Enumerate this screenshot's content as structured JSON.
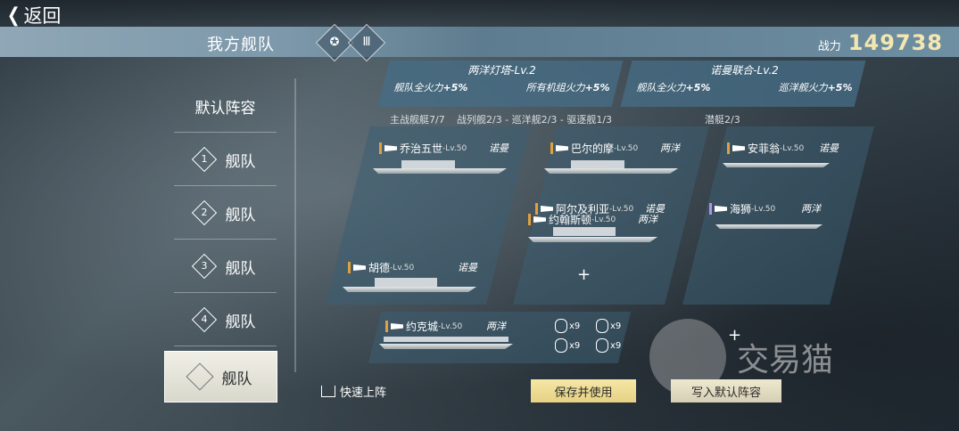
{
  "nav": {
    "back_label": "返回"
  },
  "header": {
    "title": "我方舰队",
    "power_label": "战力",
    "power_value": "149738"
  },
  "sidebar": {
    "default_label": "默认阵容",
    "items": [
      {
        "num": "1",
        "label": "舰队"
      },
      {
        "num": "2",
        "label": "舰队"
      },
      {
        "num": "3",
        "label": "舰队"
      },
      {
        "num": "4",
        "label": "舰队"
      }
    ],
    "active_label": "舰队"
  },
  "bonuses": [
    {
      "title": "两洋灯塔-Lv.2",
      "left": "舰队全火力",
      "left_pct": "+5%",
      "right": "所有机组火力",
      "right_pct": "+5%"
    },
    {
      "title": "诺曼联合-Lv.2",
      "left": "舰队全火力",
      "left_pct": "+5%",
      "right": "巡洋舰火力",
      "right_pct": "+5%"
    }
  ],
  "summary": {
    "main": "主战舰艇7/7",
    "detail": "战列舰2/3 - 巡洋舰2/3 - 驱逐舰1/3",
    "sub": "潜艇2/3"
  },
  "ships": [
    {
      "name": "乔治五世",
      "lv": "-Lv.50",
      "nation": "诺曼"
    },
    {
      "name": "胡德",
      "lv": "-Lv.50",
      "nation": "诺曼"
    },
    {
      "name": "巴尔的摩",
      "lv": "-Lv.50",
      "nation": "两洋"
    },
    {
      "name": "阿尔及利亚",
      "lv": "-Lv.50",
      "nation": "诺曼"
    },
    {
      "name": "约翰斯顿",
      "lv": "-Lv.50",
      "nation": "两洋"
    },
    {
      "name": "约克城",
      "lv": "-Lv.50",
      "nation": "两洋"
    },
    {
      "name": "安菲翁",
      "lv": "-Lv.50",
      "nation": "诺曼"
    },
    {
      "name": "海狮",
      "lv": "-Lv.50",
      "nation": "两洋"
    }
  ],
  "ammo": [
    "x9",
    "x9",
    "x9",
    "x9"
  ],
  "buttons": {
    "quick": "快速上阵",
    "save": "保存并使用",
    "write_default": "写入默认阵容"
  },
  "watermark": "交易猫"
}
